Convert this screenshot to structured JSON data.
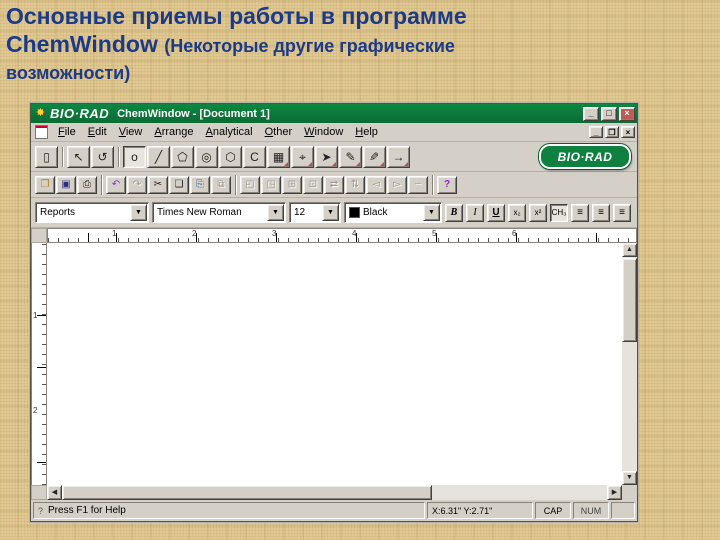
{
  "slide": {
    "title_line1": "Основные приемы работы в программе",
    "title_line2_bold": "ChemWindow ",
    "title_line2_paren": "(Некоторые другие графические",
    "title_line3": "возможности)"
  },
  "window": {
    "titlebar": {
      "brand": "BIO·RAD",
      "title": "ChemWindow - [Document 1]",
      "minimize": "_",
      "maximize": "□",
      "close": "×"
    },
    "menu": {
      "items": [
        "File",
        "Edit",
        "View",
        "Arrange",
        "Analytical",
        "Other",
        "Window",
        "Help"
      ],
      "mdi_minimize": "_",
      "mdi_restore": "❐",
      "mdi_close": "×"
    },
    "main_toolbar": {
      "badge": "BIO·RAD",
      "tools": [
        {
          "name": "new-document",
          "glyph": "▯"
        },
        {
          "name": "select-pointer",
          "glyph": "↖"
        },
        {
          "name": "lasso-select",
          "glyph": "↺"
        },
        {
          "name": "ring-bond",
          "glyph": "o"
        },
        {
          "name": "bond",
          "glyph": "╱"
        },
        {
          "name": "cyclopentane-ring",
          "glyph": "⬠"
        },
        {
          "name": "benzene-ring",
          "glyph": "◎"
        },
        {
          "name": "cyclohexane-ring",
          "glyph": "⬡"
        },
        {
          "name": "open-ring",
          "glyph": "C"
        },
        {
          "name": "template-grid",
          "glyph": "▦"
        },
        {
          "name": "orbital",
          "glyph": "⌖"
        },
        {
          "name": "arrow",
          "glyph": "➤"
        },
        {
          "name": "pen",
          "glyph": "✎"
        },
        {
          "name": "pencil",
          "glyph": "✎"
        },
        {
          "name": "reaction-arrow",
          "glyph": "→"
        }
      ]
    },
    "standard_toolbar": {
      "buttons": [
        {
          "name": "open",
          "glyph": "❐"
        },
        {
          "name": "save",
          "glyph": "▣"
        },
        {
          "name": "print",
          "glyph": "⎙"
        },
        {
          "name": "undo",
          "glyph": "↶"
        },
        {
          "name": "redo",
          "glyph": "↷"
        },
        {
          "name": "cut",
          "glyph": "✂"
        },
        {
          "name": "copy",
          "glyph": "❏"
        },
        {
          "name": "paste",
          "glyph": "⎘"
        },
        {
          "name": "duplicate",
          "glyph": "⧉"
        },
        {
          "name": "group",
          "glyph": "◰"
        },
        {
          "name": "ungroup",
          "glyph": "◳"
        },
        {
          "name": "align",
          "glyph": "⊞"
        },
        {
          "name": "distribute",
          "glyph": "⊡"
        },
        {
          "name": "flip-horizontal",
          "glyph": "⇄"
        },
        {
          "name": "flip-vertical",
          "glyph": "⇅"
        },
        {
          "name": "rotate-left",
          "glyph": "◅"
        },
        {
          "name": "rotate-right",
          "glyph": "▻"
        },
        {
          "name": "dotted-line",
          "glyph": "┈"
        },
        {
          "name": "help",
          "glyph": "?"
        }
      ]
    },
    "text_toolbar": {
      "style_value": "Reports",
      "font_value": "Times New Roman",
      "size_value": "12",
      "color_value": "Black",
      "bold": "B",
      "italic": "I",
      "underline": "U",
      "subscript": "x₂",
      "superscript": "x²",
      "formula": "CH₃",
      "align_glyph": "≡",
      "dropdown_arrow": "▼"
    },
    "ruler": {
      "h_numbers": [
        "1",
        "2",
        "3",
        "4",
        "5",
        "6"
      ],
      "v_numbers": [
        "1",
        "2"
      ]
    },
    "scrollbar": {
      "up": "▲",
      "down": "▼",
      "left": "◀",
      "right": "▶"
    },
    "statusbar": {
      "help_icon": "?",
      "message": "Press F1 for Help",
      "coords": "X:6.31\"  Y:2.71\"",
      "cap": "CAP",
      "num": "NUM"
    }
  }
}
